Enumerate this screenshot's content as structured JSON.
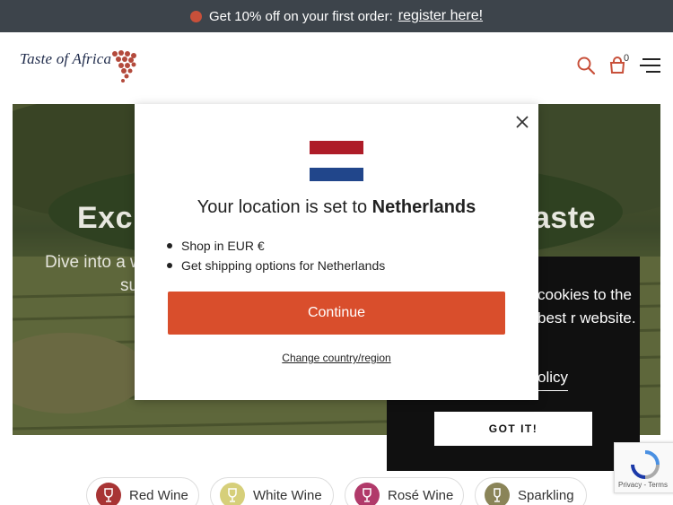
{
  "announcement": {
    "text": "Get 10% off on your first order:",
    "link": "register here!"
  },
  "header": {
    "logo_text": "Taste of Africa",
    "cart_count": "0",
    "icons": [
      "search-icon",
      "cart-icon",
      "menu-icon"
    ]
  },
  "hero": {
    "title_left": "Excl",
    "title_right": "aste",
    "subtitle_line1": "Dive into a w",
    "subtitle_line2": "su"
  },
  "modal": {
    "title_prefix": "Your location is set to",
    "country": "Netherlands",
    "bullets": [
      "Shop in EUR €",
      "Get shipping options for Netherlands"
    ],
    "continue_label": "Continue",
    "change_label": "Change country/region",
    "flag_colors": [
      "#ae1c28",
      "#ffffff",
      "#21468b"
    ]
  },
  "cookie": {
    "text": "cookies to the best r website.",
    "policy_label": "olicy",
    "button_label": "GOT IT!"
  },
  "categories": [
    {
      "label": "Red Wine",
      "color": "#a83434"
    },
    {
      "label": "White Wine",
      "color": "#d6cf7a"
    },
    {
      "label": "Rosé Wine",
      "color": "#b13a6a"
    },
    {
      "label": "Sparkling",
      "color": "#8a8458"
    }
  ],
  "colors": {
    "accent": "#d94e2c",
    "announcement_bg": "#3d444b"
  }
}
